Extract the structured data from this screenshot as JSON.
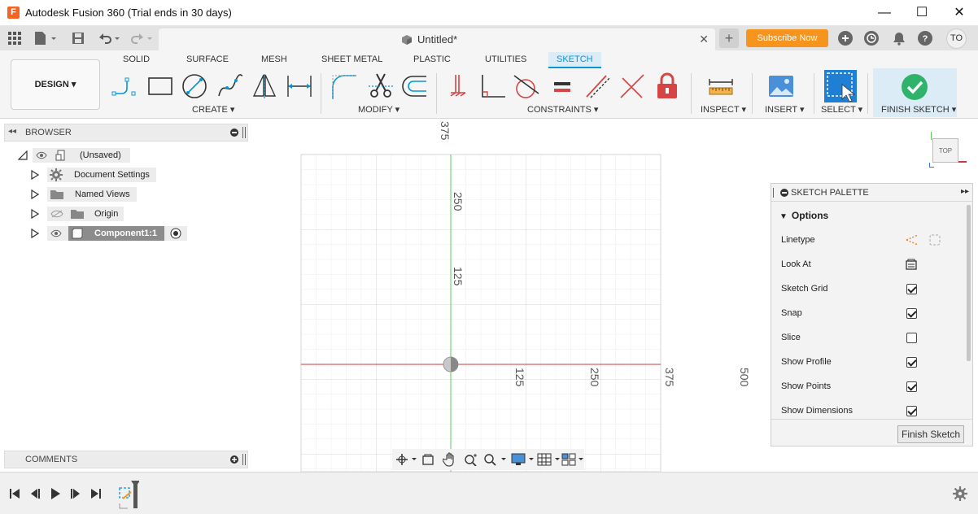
{
  "window": {
    "app_icon_letter": "F",
    "title": "Autodesk Fusion 360 (Trial ends in 30 days)",
    "minimize": "—",
    "maximize": "☐",
    "close": "✕"
  },
  "tabstrip": {
    "doc_title": "Untitled*",
    "close_tab": "✕",
    "new_tab": "+",
    "subscribe_label": "Subscribe Now",
    "user_initials": "TO"
  },
  "ribbon": {
    "workspace": "DESIGN ▾",
    "tabs": [
      "SOLID",
      "SURFACE",
      "MESH",
      "SHEET METAL",
      "PLASTIC",
      "UTILITIES",
      "SKETCH"
    ],
    "active_tab": "SKETCH",
    "groups": {
      "create": "CREATE ▾",
      "modify": "MODIFY ▾",
      "constraints": "CONSTRAINTS ▾",
      "inspect": "INSPECT ▾",
      "insert": "INSERT ▾",
      "select": "SELECT ▾",
      "finish": "FINISH SKETCH ▾"
    }
  },
  "browser": {
    "title": "BROWSER",
    "root_label": "(Unsaved)",
    "items": [
      {
        "label": "Document Settings"
      },
      {
        "label": "Named Views"
      },
      {
        "label": "Origin"
      },
      {
        "label": "Component1:1"
      }
    ],
    "comments_label": "COMMENTS"
  },
  "canvas": {
    "ticks_vertical": [
      "375",
      "250",
      "125"
    ],
    "ticks_horizontal": [
      "125",
      "250",
      "375",
      "500"
    ],
    "viewcube_label": "TOP",
    "axis_x_color": "#c83c3c",
    "axis_y_color": "#5fc95f"
  },
  "palette": {
    "title": "SKETCH PALETTE",
    "section": "Options",
    "rows": [
      {
        "label": "Linetype"
      },
      {
        "label": "Look At"
      },
      {
        "label": "Sketch Grid",
        "checked": true
      },
      {
        "label": "Snap",
        "checked": true
      },
      {
        "label": "Slice",
        "checked": false
      },
      {
        "label": "Show Profile",
        "checked": true
      },
      {
        "label": "Show Points",
        "checked": true
      },
      {
        "label": "Show Dimensions",
        "checked": true
      }
    ],
    "finish_button": "Finish Sketch"
  },
  "colors": {
    "accent": "#0696d7",
    "subscribe": "#f7941d",
    "finish_check": "#2fb36a",
    "lock_red": "#d64545"
  }
}
